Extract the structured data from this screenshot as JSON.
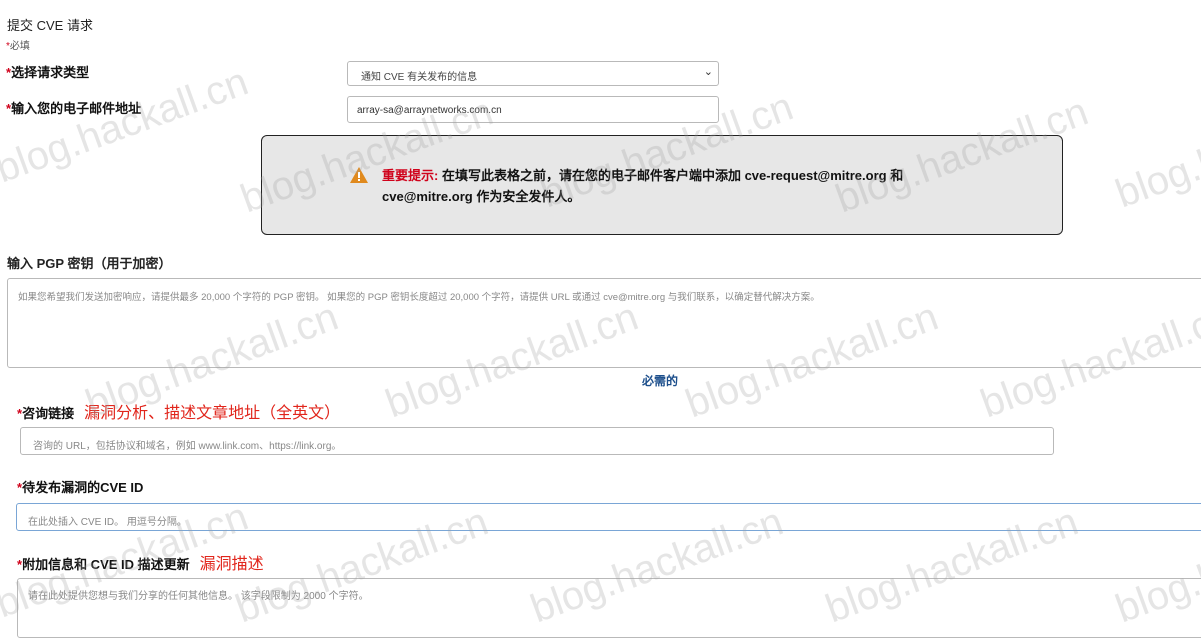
{
  "page": {
    "title": "提交 CVE 请求",
    "required_note": "必填"
  },
  "request_type": {
    "label": "选择请求类型",
    "selected_value": "通知 CVE 有关发布的信息"
  },
  "email": {
    "label": "输入您的电子邮件地址",
    "value": "array-sa@arraynetworks.com.cn"
  },
  "alert": {
    "title": "重要提示:",
    "message": "在填写此表格之前，请在您的电子邮件客户端中添加 cve-request@mitre.org 和 cve@mitre.org 作为安全发件人。"
  },
  "pgp": {
    "label": "输入 PGP 密钥（用于加密）",
    "placeholder": "如果您希望我们发送加密响应，请提供最多 20,000 个字符的 PGP 密钥。 如果您的 PGP 密钥长度超过 20,000 个字符，请提供 URL 或通过 cve@mitre.org 与我们联系，以确定替代解决方案。"
  },
  "required_section": "必需的",
  "advisory": {
    "label": "咨询链接",
    "annotation": "漏洞分析、描述文章地址（全英文）",
    "placeholder": "咨询的 URL，包括协议和域名，例如 www.link.com、https://link.org。"
  },
  "cve_ids": {
    "label": "待发布漏洞的CVE ID",
    "placeholder": "在此处插入 CVE ID。 用逗号分隔。"
  },
  "additional": {
    "label": "附加信息和 CVE ID 描述更新",
    "annotation": "漏洞描述",
    "placeholder": "请在此处提供您想与我们分享的任何其他信息。 该字段限制为 2000 个字符。"
  },
  "required_star": "*",
  "watermark": "blog.hackall.cn",
  "colors": {
    "required_star": "#d0021b",
    "annotation_red": "#e1251b",
    "link_blue": "#1d4f8c",
    "alert_bg": "#e7e7e7",
    "warning_icon": "#e08a1e"
  },
  "icons": {
    "select_arrow": "chevron-down-icon",
    "alert": "warning-triangle-icon"
  }
}
